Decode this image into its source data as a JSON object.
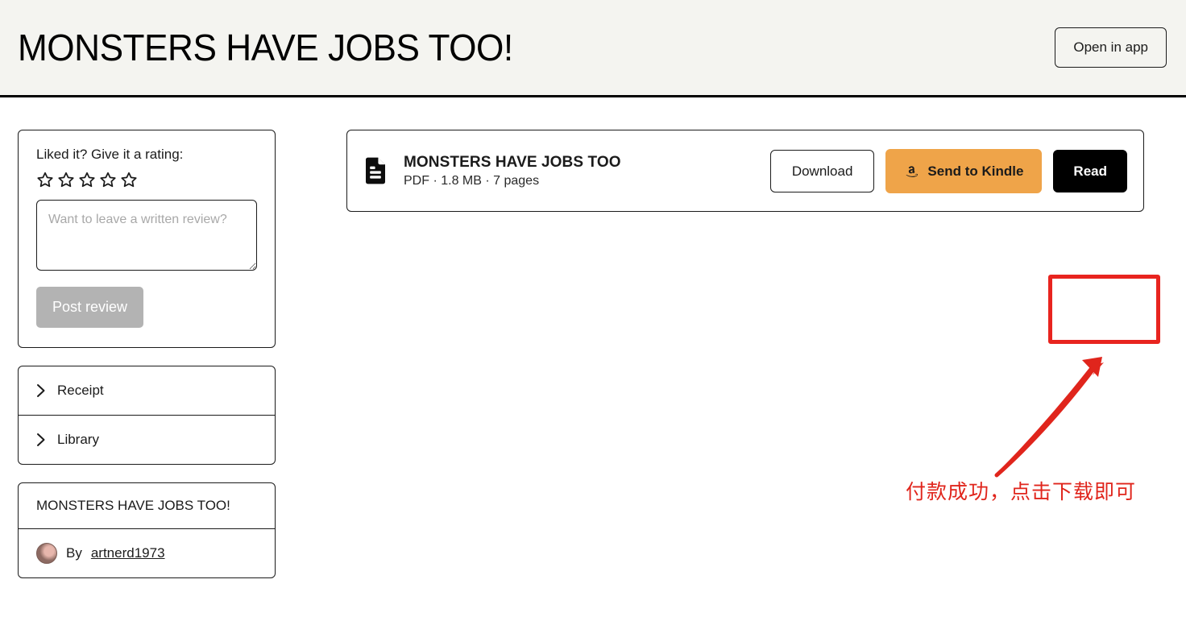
{
  "header": {
    "title": "MONSTERS HAVE JOBS TOO!",
    "open_in_app_label": "Open in app"
  },
  "sidebar": {
    "rating": {
      "prompt": "Liked it? Give it a rating:",
      "stars_total": 5,
      "stars_filled": 0,
      "review_placeholder": "Want to leave a written review?",
      "review_value": "",
      "post_button_label": "Post review"
    },
    "accordion": [
      {
        "label": "Receipt",
        "icon": "chevron-right-icon"
      },
      {
        "label": "Library",
        "icon": "chevron-right-icon"
      }
    ],
    "product_info": {
      "title": "MONSTERS HAVE JOBS TOO!",
      "by_prefix": "By",
      "author": "artnerd1973"
    }
  },
  "main": {
    "file": {
      "icon": "document-icon",
      "name": "MONSTERS HAVE JOBS TOO",
      "meta": "PDF · 1.8 MB · 7 pages",
      "format": "PDF",
      "size": "1.8 MB",
      "pages": "7 pages"
    },
    "actions": {
      "download_label": "Download",
      "kindle_label": "Send to Kindle",
      "kindle_icon": "amazon-icon",
      "read_label": "Read"
    }
  },
  "annotations": {
    "highlight_color": "#e8241f",
    "arrow_color": "#e0251c",
    "note_text": "付款成功，点击下载即可"
  },
  "colors": {
    "header_bg": "#f4f4f0",
    "body_bg": "#ffffff",
    "kindle_orange": "#efa449",
    "read_black": "#000000",
    "disabled_gray": "#b3b3b3"
  }
}
